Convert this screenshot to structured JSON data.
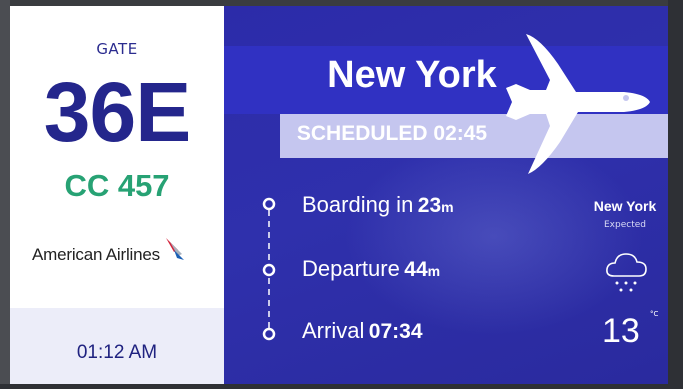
{
  "gate": {
    "label": "GATE",
    "number": "36E"
  },
  "flight": {
    "number": "CC 457"
  },
  "airline": {
    "name": "American Airlines",
    "logo": "american-airlines-flight-symbol"
  },
  "clock": {
    "time": "01:12 AM"
  },
  "destination": {
    "city": "New York",
    "status": "SCHEDULED 02:45",
    "icon": "airplane-icon"
  },
  "timeline": [
    {
      "label": "Boarding in",
      "value": "23",
      "unit": "m"
    },
    {
      "label": "Departure",
      "value": "44",
      "unit": "m"
    },
    {
      "label": "Arrival",
      "value": "07:34",
      "unit": ""
    }
  ],
  "weather": {
    "city": "New York",
    "status": "Expected",
    "icon": "snow-cloud-icon",
    "temp": "13",
    "unit": "°C"
  },
  "colors": {
    "navy": "#24268c",
    "green": "#27a274",
    "panel_blue": "#2f30ac",
    "band_blue": "#3031c2",
    "scheduled_band": "#c5c6ef",
    "clock_band": "#ecedf9"
  }
}
